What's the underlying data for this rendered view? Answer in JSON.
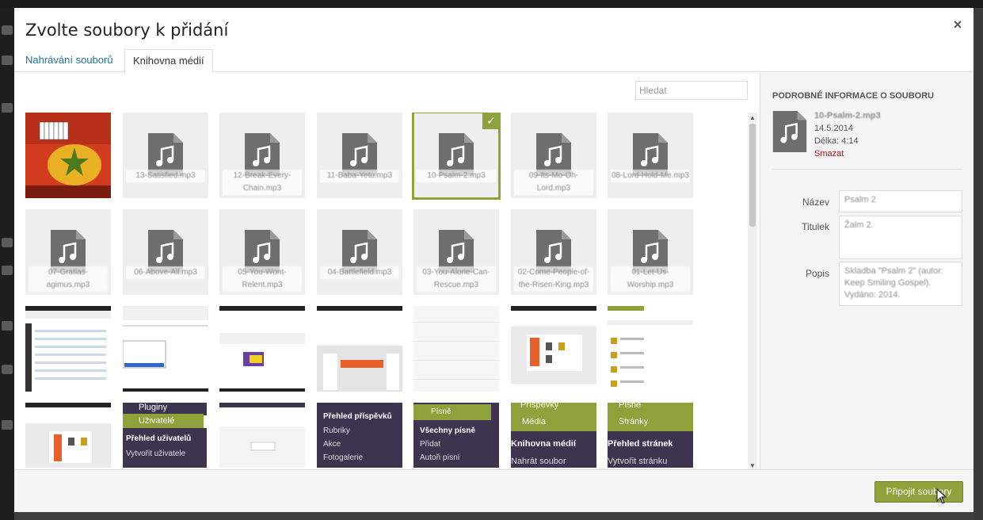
{
  "modal": {
    "title": "Zvolte soubory k přidání",
    "close_symbol": "×"
  },
  "tabs": [
    {
      "label": "Nahrávání souborů",
      "active": false
    },
    {
      "label": "Knihovna médií",
      "active": true
    }
  ],
  "search": {
    "placeholder": "Hledat"
  },
  "media_items": [
    {
      "type": "image",
      "name": ""
    },
    {
      "type": "audio",
      "name": "13-Satisfied.mp3"
    },
    {
      "type": "audio",
      "name": "12-Break-Every-Chain.mp3"
    },
    {
      "type": "audio",
      "name": "11-Baba-Yetu.mp3"
    },
    {
      "type": "audio",
      "name": "10-Psalm-2.mp3",
      "selected": true
    },
    {
      "type": "audio",
      "name": "09-Its-Mo-Oh-Lord.mp3"
    },
    {
      "type": "audio",
      "name": "08-Lord-Hold-Me.mp3"
    },
    {
      "type": "audio",
      "name": "07-Gratias-agimus.mp3"
    },
    {
      "type": "audio",
      "name": "06-Above-All.mp3"
    },
    {
      "type": "audio",
      "name": "05-You-Wont-Relent.mp3"
    },
    {
      "type": "audio",
      "name": "04-Battlefield.mp3"
    },
    {
      "type": "audio",
      "name": "03-You-Alone-Can-Rescue.mp3"
    },
    {
      "type": "audio",
      "name": "02-Come-People-of-the-Risen-King.mp3"
    },
    {
      "type": "audio",
      "name": "01-Let-Us-Worship.mp3"
    }
  ],
  "screenshot_thumbs": {
    "menu_users": [
      "Pluginy",
      "Uživatelé",
      "Přehled uživatelů",
      "Vytvořit uživatele"
    ],
    "menu_posts": [
      "Přehled příspěvků",
      "Rubriky",
      "Akce",
      "Fotogalerie"
    ],
    "menu_songs": [
      "Písně",
      "Všechny písně",
      "Přidat",
      "Autoři písní"
    ],
    "menu_media": [
      "Příspěvky",
      "Média",
      "Knihovna médií",
      "Nahrát soubor"
    ],
    "menu_pages": [
      "Písně",
      "Stránky",
      "Přehled stránek",
      "Vytvořit stránku"
    ]
  },
  "details": {
    "heading": "PODROBNÉ INFORMACE O SOUBORU",
    "filename": "10-Psalm-2.mp3",
    "date": "14.5.2014",
    "length": "Délka: 4:14",
    "delete_label": "Smazat",
    "fields": [
      {
        "label": "Název",
        "value": "Psalm 2"
      },
      {
        "label": "Titulek",
        "value": "Žalm 2."
      },
      {
        "label": "Popis",
        "value": "Skladba \"Psalm 2\" (autor: Keep Smiling Gospel). Vydáno: 2014."
      }
    ]
  },
  "footer": {
    "insert_label": "Připojit soubory"
  },
  "colors": {
    "accent": "#8fa13a",
    "link": "#21759b",
    "delete": "#bc0b0b"
  }
}
